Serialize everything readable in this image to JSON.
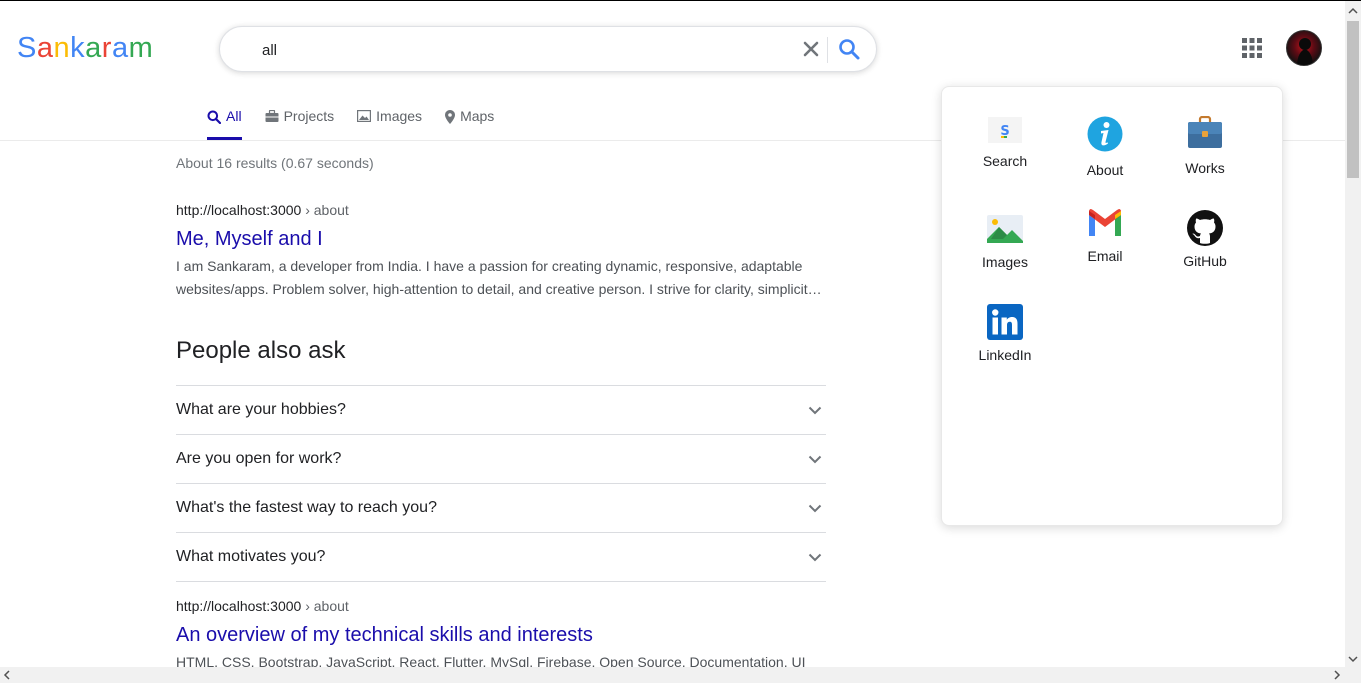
{
  "logo": {
    "letters": [
      "S",
      "a",
      "n",
      "k",
      "a",
      "r",
      "a",
      "m"
    ],
    "colors": [
      "#4285f4",
      "#ea4335",
      "#fbbc05",
      "#4285f4",
      "#34a853",
      "#ea4335",
      "#4285f4",
      "#34a853"
    ]
  },
  "search": {
    "value": "all",
    "clear_icon": "close-icon",
    "search_icon": "search-icon"
  },
  "header": {
    "apps_icon": "grid-icon",
    "avatar_icon": "avatar"
  },
  "tabs": [
    {
      "label": "All",
      "icon": "search-icon",
      "active": true
    },
    {
      "label": "Projects",
      "icon": "briefcase-icon",
      "active": false
    },
    {
      "label": "Images",
      "icon": "image-icon",
      "active": false
    },
    {
      "label": "Maps",
      "icon": "map-pin-icon",
      "active": false
    }
  ],
  "stats": "About 16 results (0.67 seconds)",
  "results": [
    {
      "url": "http://localhost:3000",
      "crumb": " › about",
      "title": "Me, Myself and I",
      "snippet_lines": [
        "I am Sankaram, a developer from India. I have a passion for creating dynamic, responsive, adaptable",
        "websites/apps. Problem solver, high-attention to detail, and creative person. I strive for clarity, simplicity and efficiency."
      ]
    },
    {
      "url": "http://localhost:3000",
      "crumb": " › about",
      "title": "An overview of my technical skills and interests",
      "snippet_lines": [
        "HTML, CSS, Bootstrap, JavaScript, React, Flutter, MySql, Firebase, Open Source, Documentation, UI"
      ]
    }
  ],
  "people_also_ask": {
    "title": "People also ask",
    "items": [
      "What are your hobbies?",
      "Are you open for work?",
      "What's the fastest way to reach you?",
      "What motivates you?"
    ]
  },
  "apps_panel": {
    "apps": [
      {
        "label": "Search",
        "icon": "search-app-icon"
      },
      {
        "label": "About",
        "icon": "info-icon"
      },
      {
        "label": "Works",
        "icon": "briefcase-icon"
      },
      {
        "label": "Images",
        "icon": "image-icon"
      },
      {
        "label": "Email",
        "icon": "gmail-icon"
      },
      {
        "label": "GitHub",
        "icon": "github-icon"
      },
      {
        "label": "LinkedIn",
        "icon": "linkedin-icon"
      }
    ]
  },
  "colors": {
    "link": "#1a0dab",
    "accent_blue": "#4285f4",
    "text_gray": "#5f6368"
  }
}
